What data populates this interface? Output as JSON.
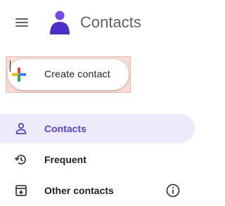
{
  "app": {
    "title": "Contacts",
    "logo_icon": "contacts-person-logo",
    "menu_icon": "hamburger-menu-icon"
  },
  "create": {
    "label": "Create contact",
    "icon": "multicolor-plus-icon"
  },
  "nav": {
    "items": [
      {
        "label": "Contacts",
        "icon": "person-outline-icon",
        "active": true
      },
      {
        "label": "Frequent",
        "icon": "history-icon",
        "active": false
      },
      {
        "label": "Other contacts",
        "icon": "archive-download-icon",
        "active": false
      }
    ],
    "info_icon": "info-icon"
  },
  "colors": {
    "accent": "#5b3fd0",
    "active_bg": "#ecebfc",
    "highlight": "#f7ddd5"
  }
}
